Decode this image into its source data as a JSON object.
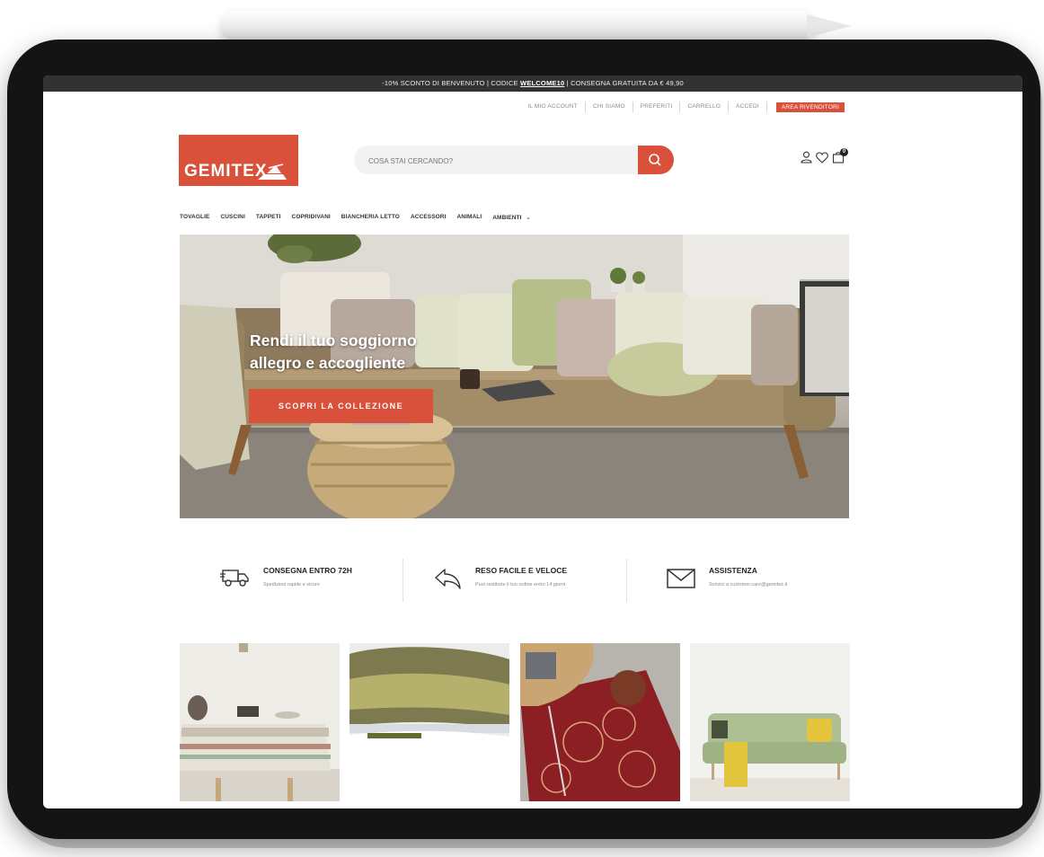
{
  "announcement": {
    "prefix": "-10% SCONTO DI BENVENUTO | CODICE ",
    "code": "WELCOME10",
    "suffix": " | CONSEGNA GRATUITA DA € 49,90"
  },
  "utility_nav": {
    "items": [
      "IL MIO ACCOUNT",
      "CHI SIAMO",
      "PREFERITI",
      "CARRELLO",
      "ACCEDI"
    ],
    "dealer_button": "AREA RIVENDITORI"
  },
  "brand": {
    "name": "GEMITEX",
    "color": "#d9513a"
  },
  "search": {
    "placeholder": "COSA STAI CERCANDO?"
  },
  "header_icons": {
    "account": "user-icon",
    "wishlist": "heart-icon",
    "cart": "bag-icon",
    "cart_count": "0"
  },
  "main_nav": {
    "items": [
      "TOVAGLIE",
      "CUSCINI",
      "TAPPETI",
      "COPRIDIVANI",
      "BIANCHERIA LETTO",
      "ACCESSORI",
      "ANIMALI",
      "AMBIENTI"
    ],
    "dropdown_indicator": "⌄"
  },
  "hero": {
    "title": "Rendi il tuo soggiorno\nallegro e accogliente",
    "cta": "SCOPRI LA COLLEZIONE"
  },
  "features": [
    {
      "icon": "truck-icon",
      "title": "CONSEGNA ENTRO 72H",
      "desc": "Spedizioni rapide e sicure"
    },
    {
      "icon": "return-arrow-icon",
      "title": "RESO FACILE E VELOCE",
      "desc": "Puoi restituire il tuo ordine entro 14 giorni"
    },
    {
      "icon": "envelope-icon",
      "title": "ASSISTENZA",
      "desc": "Scrivici a customer.care@gemitex.it"
    }
  ],
  "category_tiles": [
    "tablecloth-photo",
    "cushion-photo",
    "rug-photo",
    "sofa-cover-photo"
  ]
}
